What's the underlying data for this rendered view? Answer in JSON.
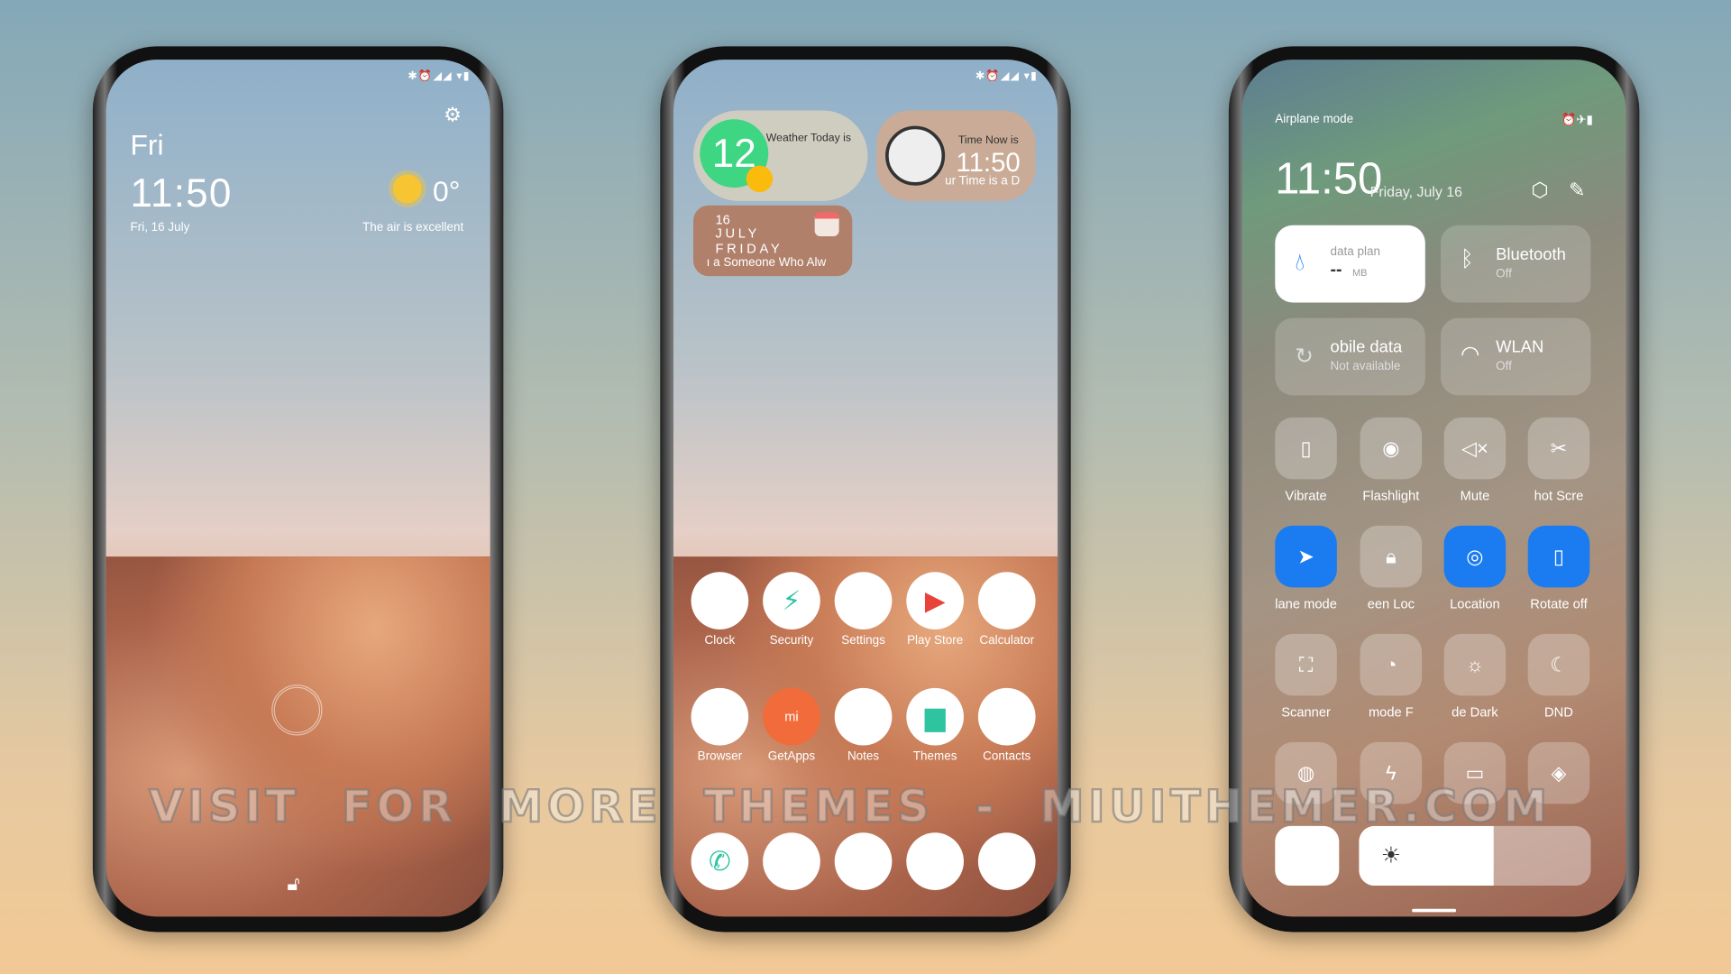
{
  "status_icons": "✱⏰◢◢ ▾▮",
  "lock": {
    "day": "Fri",
    "time": "11:50",
    "date": "Fri, 16 July",
    "temp": "0°",
    "air": "The air is excellent",
    "icons": [
      "gear-icon",
      "sun-icon",
      "fingerprint-icon",
      "unlock-icon"
    ]
  },
  "home": {
    "weather_widget": {
      "label": "Weather Today is",
      "badge": "12"
    },
    "clock_widget": {
      "label": "Time Now is",
      "time": "11:50",
      "sub": "ur Time is a D"
    },
    "date_widget": {
      "day": "16",
      "month": "JULY",
      "weekday": "FRIDAY",
      "sub": "ı a Someone Who Alw"
    },
    "apps_row1": [
      "Clock",
      "Security",
      "Settings",
      "Play Store",
      "Calculator"
    ],
    "apps_row2": [
      "Browser",
      "GetApps",
      "Notes",
      "Themes",
      "Contacts"
    ],
    "dock": [
      "phone-icon",
      "messages-icon",
      "store-icon",
      "gallery-icon",
      "camera-icon"
    ]
  },
  "control": {
    "airplane": "Airplane mode",
    "time": "11:50",
    "date": "Friday, July 16",
    "data_plan": {
      "label": "data plan",
      "value": "--",
      "unit": "MB"
    },
    "bluetooth": {
      "label": "Bluetooth",
      "state": "Off"
    },
    "mobile_data": {
      "label": "obile data",
      "state": "Not available"
    },
    "wlan": {
      "label": "WLAN",
      "state": "Off"
    },
    "row1": [
      "Vibrate",
      "Flashlight",
      "Mute",
      "hot   Scre"
    ],
    "row2": [
      "lane mode",
      "een     Loc",
      "Location",
      "Rotate off"
    ],
    "row3": [
      "Scanner",
      "mode    F",
      "de     Dark",
      "DND"
    ],
    "accent": "#1a7cf0"
  },
  "watermark": "VISIT FOR MORE THEMES - MIUITHEMER.COM"
}
